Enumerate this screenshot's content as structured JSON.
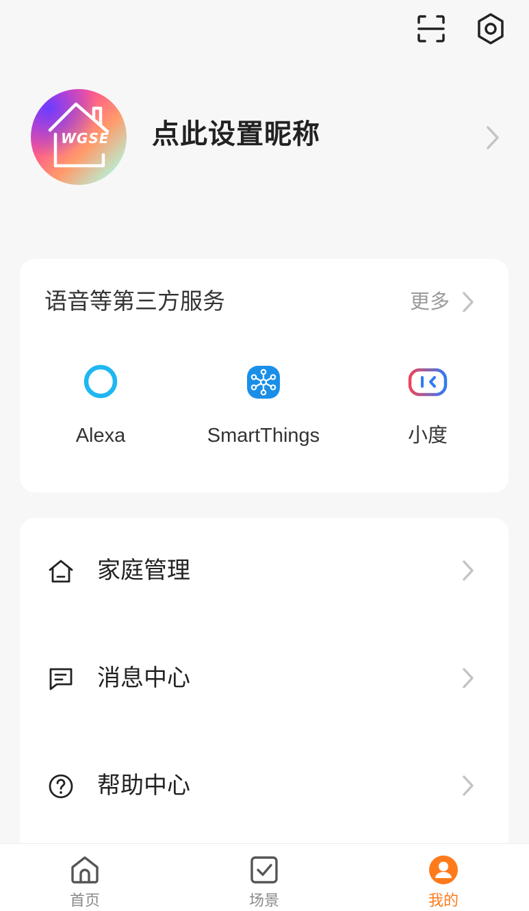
{
  "header": {
    "scan_icon": "scan-icon",
    "settings_icon": "settings-icon"
  },
  "profile": {
    "avatar_text": "WGSE",
    "nickname": "点此设置昵称"
  },
  "services": {
    "title": "语音等第三方服务",
    "more_label": "更多",
    "items": [
      {
        "label": "Alexa",
        "icon": "alexa-icon",
        "color": "#1fb7f0"
      },
      {
        "label": "SmartThings",
        "icon": "smartthings-icon",
        "color": "#1a8fe8"
      },
      {
        "label": "小度",
        "icon": "xiaodu-icon",
        "color": "#3a7cf5"
      }
    ]
  },
  "menu": {
    "items": [
      {
        "label": "家庭管理",
        "icon": "home-outline-icon"
      },
      {
        "label": "消息中心",
        "icon": "message-icon"
      },
      {
        "label": "帮助中心",
        "icon": "help-icon"
      }
    ]
  },
  "bottom_nav": {
    "active_color": "#ff7a1a",
    "items": [
      {
        "label": "首页",
        "icon": "home-icon",
        "active": false
      },
      {
        "label": "场景",
        "icon": "scene-checkbox-icon",
        "active": false
      },
      {
        "label": "我的",
        "icon": "profile-icon",
        "active": true
      }
    ]
  }
}
